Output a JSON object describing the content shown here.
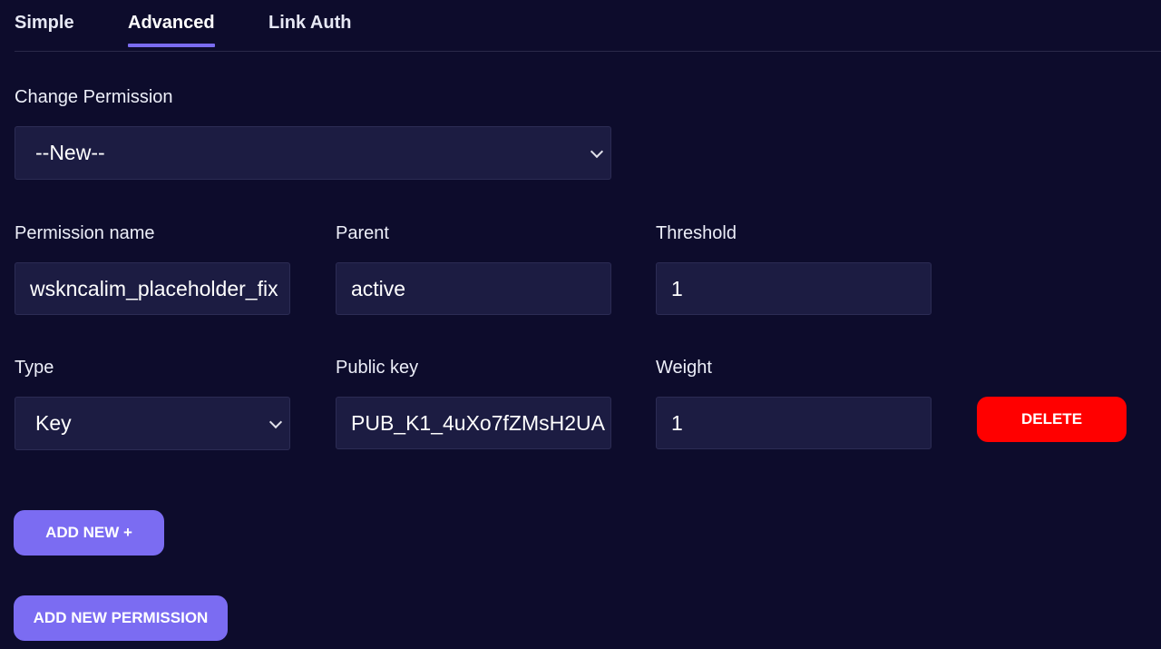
{
  "tabs": [
    {
      "label": "Simple",
      "active": false
    },
    {
      "label": "Advanced",
      "active": true
    },
    {
      "label": "Link Auth",
      "active": false
    }
  ],
  "change_permission": {
    "label": "Change Permission",
    "selected": "--New--"
  },
  "permission_name": {
    "label": "Permission name",
    "value": "wskncalim_placeholder_fix"
  },
  "parent": {
    "label": "Parent",
    "value": "active"
  },
  "threshold": {
    "label": "Threshold",
    "value": "1"
  },
  "type": {
    "label": "Type",
    "selected": "Key"
  },
  "public_key": {
    "label": "Public key",
    "value": "PUB_K1_4uXo7fZMsH2UA"
  },
  "weight": {
    "label": "Weight",
    "value": "1"
  },
  "buttons": {
    "delete": "DELETE",
    "add_new": "ADD NEW +",
    "add_new_permission": "ADD NEW PERMISSION"
  },
  "colors": {
    "background": "#0d0c2c",
    "field_bg": "#1c1c42",
    "accent": "#7b6cf2",
    "danger": "#ff0000"
  }
}
